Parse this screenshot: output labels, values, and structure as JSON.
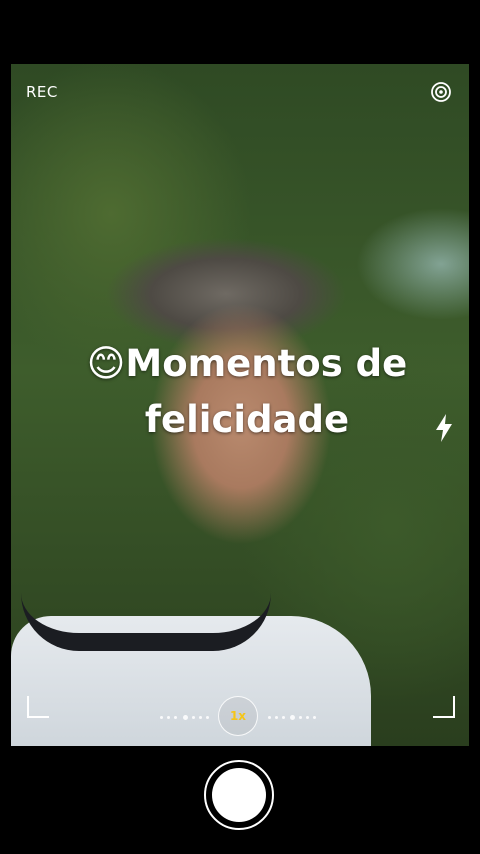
{
  "status": {
    "rec_label": "REC"
  },
  "caption": {
    "emoji": "😊",
    "line1": "Momentos de",
    "line2": "felicidade"
  },
  "zoom": {
    "label": "1x"
  },
  "icons": {
    "settings": "target-settings-icon",
    "flash": "flash-icon",
    "shutter": "shutter-button"
  },
  "colors": {
    "zoom_label": "#f5c518",
    "background": "#000000"
  }
}
